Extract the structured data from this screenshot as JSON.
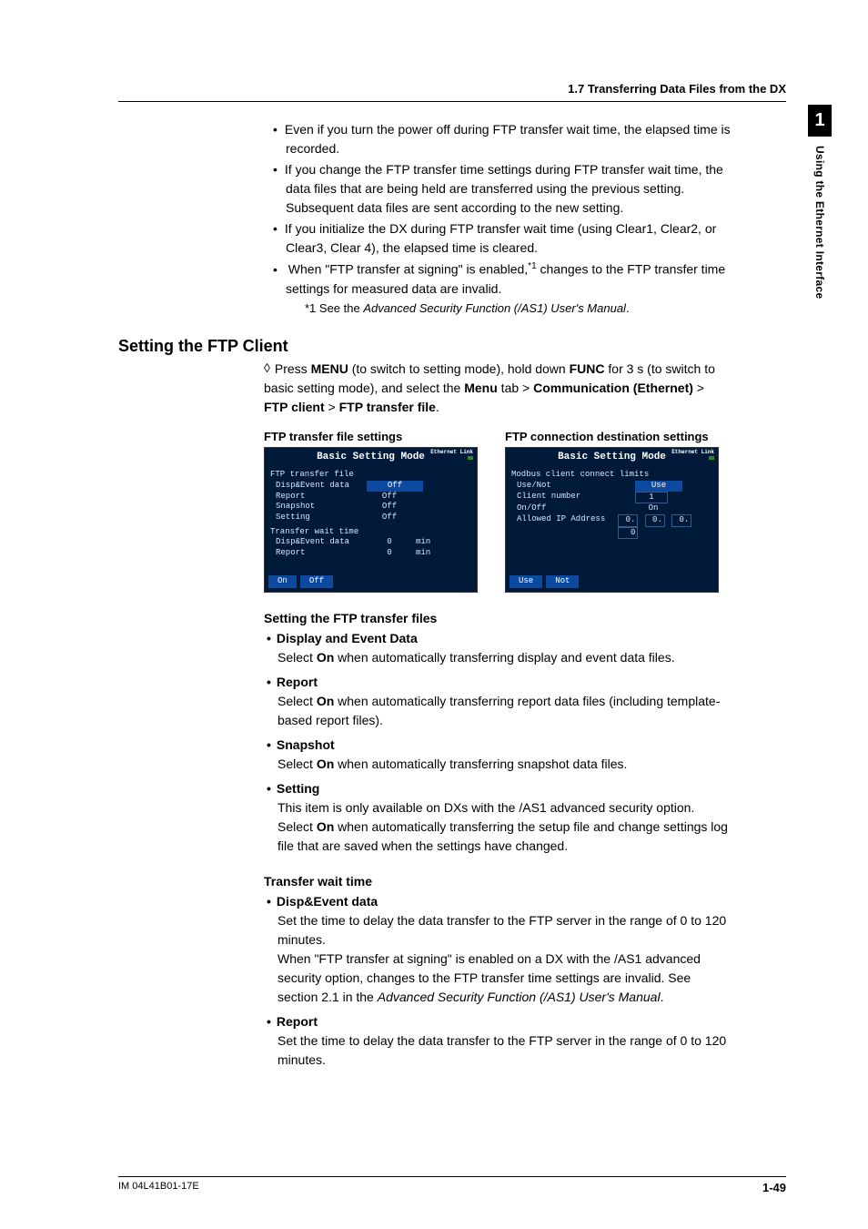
{
  "header": {
    "section": "1.7  Transferring Data Files from the DX"
  },
  "sidebar": {
    "chapter": "1",
    "label": "Using the Ethernet Interface"
  },
  "bullets_top": [
    "Even if you turn the power off during FTP transfer wait time, the elapsed time is recorded.",
    "If you change the FTP transfer time settings during FTP transfer wait time, the data files that are being held are transferred using the previous setting. Subsequent data files are sent according to the new setting.",
    "If you initialize the DX during FTP transfer wait time (using Clear1, Clear2, or Clear3, Clear 4), the elapsed time is cleared."
  ],
  "bullet_signing": {
    "pre": "When \"FTP transfer at signing\" is enabled,",
    "sup": "*1",
    "post": " changes to the FTP transfer time settings for measured data are invalid."
  },
  "footnote": {
    "pre": "*1 See the ",
    "it": "Advanced Security Function (/AS1) User's Manual",
    "post": "."
  },
  "h2": "Setting the FTP Client",
  "procedure": {
    "pre": "Press ",
    "b1": "MENU",
    "mid1": " (to switch to setting mode), hold down ",
    "b2": "FUNC",
    "mid2": " for 3 s (to switch to basic setting mode), and select the ",
    "b3": "Menu",
    "mid3": " tab > ",
    "b4": "Communication (Ethernet)",
    "mid4": " > ",
    "b5": "FTP client",
    "mid5": " > ",
    "b6": "FTP transfer file",
    "end": "."
  },
  "screens": {
    "left": {
      "caption": "FTP transfer file settings",
      "title": "Basic Setting Mode",
      "eth": "Ethernet\nLink",
      "h1": "FTP transfer file",
      "rows1": [
        {
          "l": "Disp&Event data",
          "v": "Off",
          "hl": true
        },
        {
          "l": "Report",
          "v": "Off"
        },
        {
          "l": "Snapshot",
          "v": "Off"
        },
        {
          "l": "Setting",
          "v": "Off"
        }
      ],
      "h2": "Transfer wait time",
      "rows2": [
        {
          "l": "Disp&Event data",
          "v": "0",
          "u": "min"
        },
        {
          "l": "Report",
          "v": "0",
          "u": "min"
        }
      ],
      "btns": [
        "On",
        "Off"
      ]
    },
    "right": {
      "caption": "FTP connection destination settings",
      "title": "Basic Setting Mode",
      "eth": "Ethernet\nLink",
      "h1": "Modbus client connect limits",
      "rows": [
        {
          "l": "Use/Not",
          "v": "Use",
          "hl": true
        },
        {
          "l": "Client number",
          "v": "1",
          "box": true
        },
        {
          "l": "On/Off",
          "v": "On"
        }
      ],
      "iprow": {
        "l": "Allowed IP Address",
        "parts": [
          "0.",
          "0.",
          "0.",
          "0"
        ]
      },
      "btns": [
        "Use",
        "Not"
      ]
    }
  },
  "sub1": "Setting the FTP transfer files",
  "items1": [
    {
      "t": "Display and Event Data",
      "b": [
        {
          "txt": "Select "
        },
        {
          "b": "On"
        },
        {
          "txt": " when automatically transferring display and event data files."
        }
      ]
    },
    {
      "t": "Report",
      "b": [
        {
          "txt": "Select "
        },
        {
          "b": "On"
        },
        {
          "txt": " when automatically transferring report data files (including template-based report files)."
        }
      ]
    },
    {
      "t": "Snapshot",
      "b": [
        {
          "txt": "Select "
        },
        {
          "b": "On"
        },
        {
          "txt": " when automatically transferring snapshot data files."
        }
      ]
    },
    {
      "t": "Setting",
      "b": [
        {
          "txt": "This item is only available on DXs with the /AS1 advanced security option. Select "
        },
        {
          "b": "On"
        },
        {
          "txt": " when automatically transferring the setup file and change settings log file that are saved when the settings have changed."
        }
      ]
    }
  ],
  "sub2": "Transfer wait time",
  "items2": [
    {
      "t": "Disp&Event data",
      "b": [
        {
          "txt": "Set the time to delay the data transfer to the FTP server in the range of 0 to 120 minutes."
        },
        {
          "br": true
        },
        {
          "txt": "When \"FTP transfer at signing\" is enabled on a DX with the /AS1 advanced security option, changes to the FTP transfer time settings are invalid. See section 2.1 in the "
        },
        {
          "i": "Advanced Security Function (/AS1) User's Manual"
        },
        {
          "txt": "."
        }
      ]
    },
    {
      "t": "Report",
      "b": [
        {
          "txt": "Set the time to delay the data transfer to the FTP server in the range of 0 to 120 minutes."
        }
      ]
    }
  ],
  "footer": {
    "left": "IM 04L41B01-17E",
    "right": "1-49"
  }
}
